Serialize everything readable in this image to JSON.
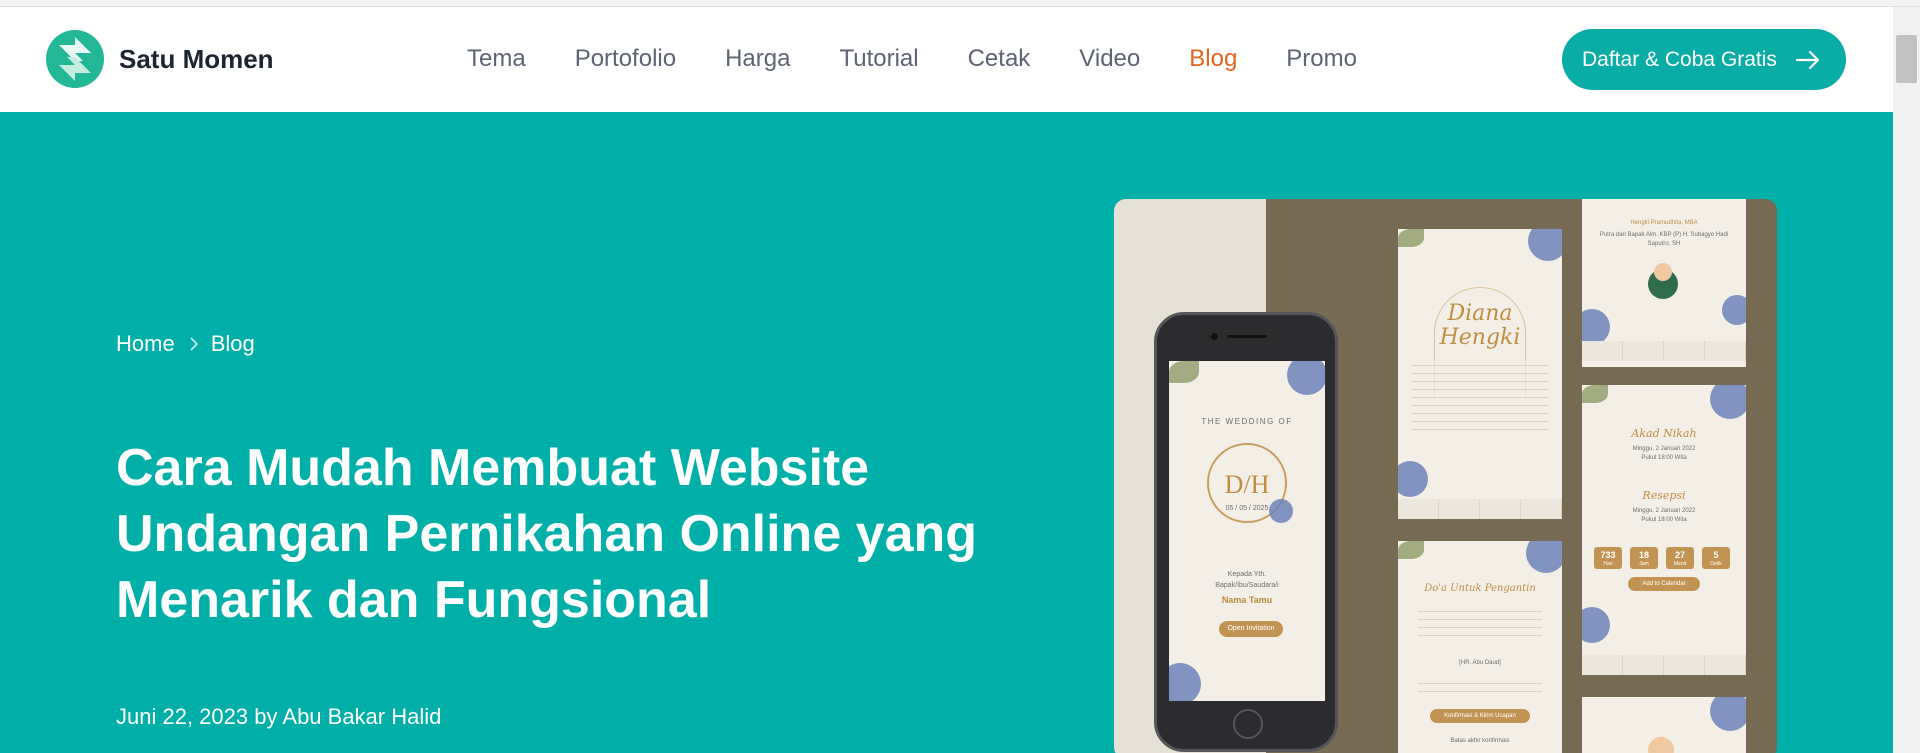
{
  "brand": {
    "name": "Satu Momen",
    "accent": "#0aada6",
    "hero_bg": "#00afa8",
    "active_color": "#e2661d"
  },
  "nav": {
    "items": [
      {
        "label": "Tema"
      },
      {
        "label": "Portofolio"
      },
      {
        "label": "Harga"
      },
      {
        "label": "Tutorial"
      },
      {
        "label": "Cetak"
      },
      {
        "label": "Video"
      },
      {
        "label": "Blog",
        "active": true
      },
      {
        "label": "Promo"
      }
    ],
    "cta_label": "Daftar & Coba Gratis"
  },
  "breadcrumb": {
    "home": "Home",
    "current": "Blog"
  },
  "article": {
    "title": "Cara Mudah Membuat Website Undangan Pernikahan Online yang Menarik dan Fungsional",
    "date": "Juni 22, 2023",
    "by": "by",
    "author": "Abu Bakar Halid"
  },
  "preview": {
    "phone": {
      "heading": "THE WEDDING OF",
      "monogram": "D/H",
      "date": "05 / 05 / 2025",
      "to_line_1": "Kepada Yth.",
      "to_line_2": "Bapak/Ibu/Saudara/i",
      "guest_name": "Nama Tamu",
      "open_button": "Open Invitation"
    },
    "card_couple": {
      "names_1": "Diana",
      "names_2": "Hengki"
    },
    "card_prayer": {
      "title": "Do'a Untuk Pengantin",
      "source": "[HR. Abu Daud]",
      "button": "Konfirmasi & Kirim Ucapan",
      "deadline": "Batas akhir konfirmasi"
    },
    "card_parents": {
      "name": "Hengki Pramudhita, MBA",
      "line": "Putra dari Bapak Alm. KBP (P) H. Subagyo Hadi Saputro, SH"
    },
    "card_event": {
      "akad": "Akad Nikah",
      "resepsi": "Resepsi",
      "akad_date": "Minggu, 2 Januari 2022",
      "akad_time": "Pukul 18:00 Wita",
      "countdown": [
        {
          "value": "733",
          "unit": "Hari"
        },
        {
          "value": "18",
          "unit": "Jam"
        },
        {
          "value": "27",
          "unit": "Menit"
        },
        {
          "value": "5",
          "unit": "Detik"
        }
      ],
      "calendar_button": "Add to Calendar"
    }
  }
}
